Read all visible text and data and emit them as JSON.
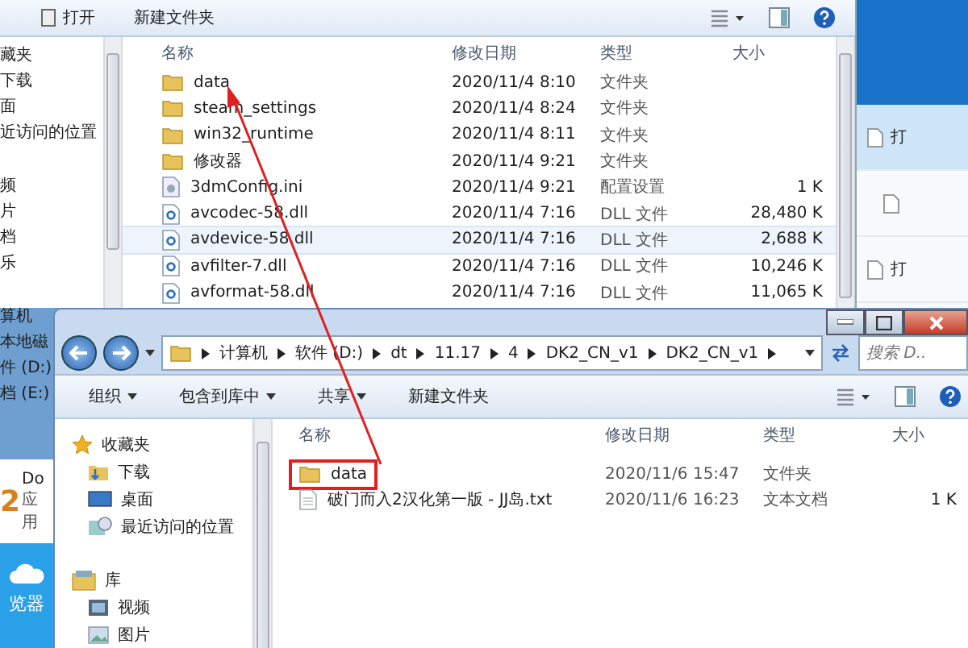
{
  "back_window": {
    "toolbar": [
      "打开",
      "新建文件夹"
    ],
    "sidebar": [
      "藏夹",
      "下载",
      "面",
      "近访问的位置",
      "频",
      "片",
      "档",
      "乐",
      "算机",
      "本地磁",
      "件 (D:)",
      "档 (E:)"
    ],
    "columns": [
      "名称",
      "修改日期",
      "类型",
      "大小"
    ],
    "files": [
      {
        "kind": "folder",
        "name": "data",
        "date": "2020/11/4 8:10",
        "type": "文件夹",
        "selected": false
      },
      {
        "kind": "folder",
        "name": "steam_settings",
        "date": "2020/11/4 8:24",
        "type": "文件夹",
        "selected": false
      },
      {
        "kind": "folder",
        "name": "win32_runtime",
        "date": "2020/11/4 8:11",
        "type": "文件夹",
        "selected": false
      },
      {
        "kind": "folder",
        "name": "修改器",
        "date": "2020/11/4 9:21",
        "type": "文件夹",
        "selected": false
      },
      {
        "kind": "config",
        "name": "3dmConfig.ini",
        "date": "2020/11/4 9:21",
        "type": "配置设置",
        "size": "1 K",
        "selected": false
      },
      {
        "kind": "dll",
        "name": "avcodec-58.dll",
        "date": "2020/11/4 7:16",
        "type": "DLL 文件",
        "size": "28,480 K",
        "selected": false
      },
      {
        "kind": "dll",
        "name": "avdevice-58.dll",
        "date": "2020/11/4 7:16",
        "type": "DLL 文件",
        "size": "2,688 K",
        "selected": true
      },
      {
        "kind": "dll",
        "name": "avfilter-7.dll",
        "date": "2020/11/4 7:16",
        "type": "DLL 文件",
        "size": "10,246 K",
        "selected": false
      },
      {
        "kind": "dll",
        "name": "avformat-58.dll",
        "date": "2020/11/4 7:16",
        "type": "DLL 文件",
        "size": "11,065 K",
        "selected": false
      }
    ]
  },
  "right_panel": {
    "items": [
      {
        "text": "打",
        "selected": true
      },
      {
        "selected": false
      },
      {
        "text": "打",
        "selected": false
      }
    ]
  },
  "desktop_app": {
    "logo": "2",
    "title": "Do",
    "subtitle": "应用",
    "caption": "览器"
  },
  "front_window": {
    "path": [
      "计算机",
      "软件 (D:)",
      "dt",
      "11.17",
      "4",
      "DK2_CN_v1",
      "DK2_CN_v1"
    ],
    "search": {
      "placeholder": "搜索 D.."
    },
    "toolbar": [
      {
        "label": "组织",
        "dropdown": true
      },
      {
        "label": "包含到库中",
        "dropdown": true
      },
      {
        "label": "共享",
        "dropdown": true
      },
      {
        "label": "新建文件夹",
        "dropdown": false
      }
    ],
    "sidebar": [
      {
        "kind": "favorites",
        "label": "收藏夹",
        "group": true
      },
      {
        "kind": "download",
        "label": "下载",
        "group": false
      },
      {
        "kind": "desktop",
        "label": "桌面",
        "group": false
      },
      {
        "kind": "recent",
        "label": "最近访问的位置",
        "group": false
      },
      {
        "kind": "library",
        "label": "库",
        "group": true
      },
      {
        "kind": "video",
        "label": "视频",
        "group": false
      },
      {
        "kind": "picture",
        "label": "图片",
        "group": false
      }
    ],
    "columns": [
      "名称",
      "修改日期",
      "类型",
      "大小"
    ],
    "files": [
      {
        "kind": "folder",
        "name": "data",
        "date": "2020/11/6 15:47",
        "type": "文件夹",
        "highlighted": true
      },
      {
        "kind": "text",
        "name": "破门而入2汉化第一版 - JJ岛.txt",
        "date": "2020/11/6 16:23",
        "type": "文本文档",
        "size": "1 K",
        "highlighted": false
      }
    ]
  },
  "annotation": {
    "arrow": true
  }
}
